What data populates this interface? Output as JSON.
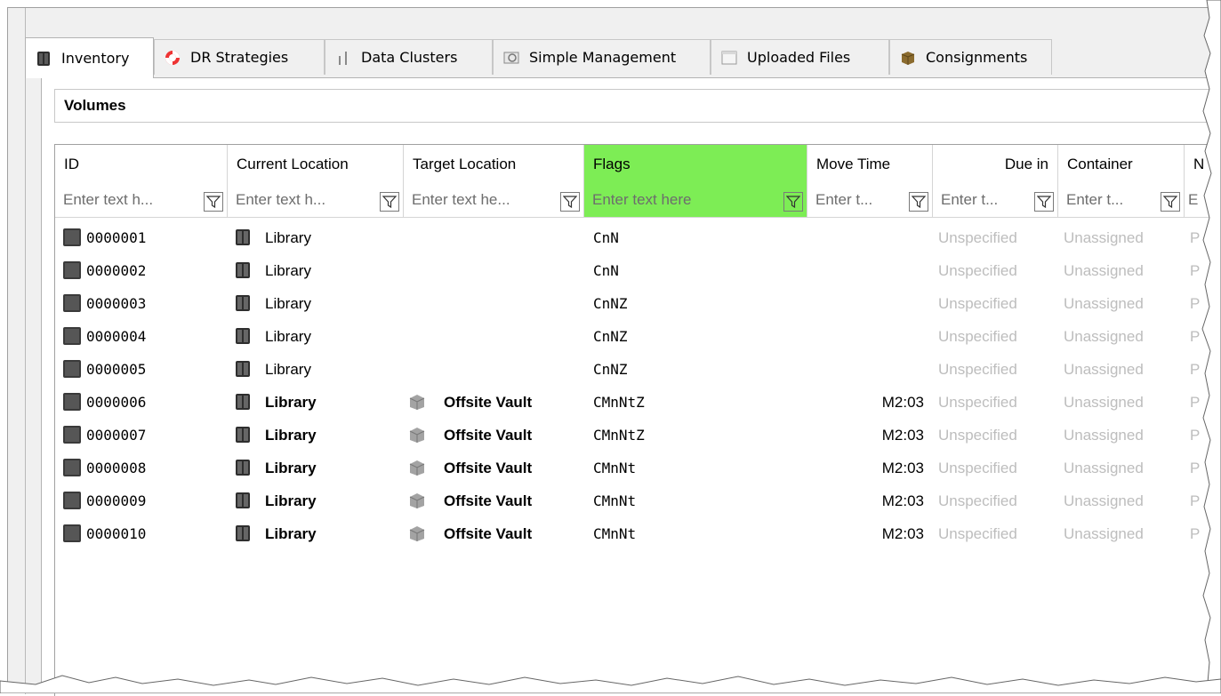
{
  "tabs": [
    {
      "label": "Inventory",
      "icon": "inventory-icon",
      "active": true
    },
    {
      "label": "DR Strategies",
      "icon": "lifebuoy-icon",
      "active": false
    },
    {
      "label": "Data Clusters",
      "icon": "data-clusters-icon",
      "active": false
    },
    {
      "label": "Simple Management",
      "icon": "simple-management-icon",
      "active": false
    },
    {
      "label": "Uploaded Files",
      "icon": "uploaded-files-icon",
      "active": false
    },
    {
      "label": "Consignments",
      "icon": "consignments-icon",
      "active": false
    }
  ],
  "section": {
    "title": "Volumes"
  },
  "grid": {
    "columns": [
      {
        "title": "ID",
        "filter_placeholder": "Enter text h..."
      },
      {
        "title": "Current Location",
        "filter_placeholder": "Enter text h..."
      },
      {
        "title": "Target Location",
        "filter_placeholder": "Enter text he..."
      },
      {
        "title": "Flags",
        "filter_placeholder": "Enter text here",
        "selected": true
      },
      {
        "title": "Move Time",
        "filter_placeholder": "Enter t..."
      },
      {
        "title": "Due in",
        "filter_placeholder": "Enter t..."
      },
      {
        "title": "Container",
        "filter_placeholder": "Enter t..."
      },
      {
        "title": "N",
        "filter_placeholder": "E"
      }
    ],
    "rows": [
      {
        "id": "0000001",
        "current": "Library",
        "target": "",
        "flags": "CnN",
        "move_time": "",
        "due_in": "Unspecified",
        "container": "Unassigned",
        "next": "P",
        "bold": false
      },
      {
        "id": "0000002",
        "current": "Library",
        "target": "",
        "flags": "CnN",
        "move_time": "",
        "due_in": "Unspecified",
        "container": "Unassigned",
        "next": "P",
        "bold": false
      },
      {
        "id": "0000003",
        "current": "Library",
        "target": "",
        "flags": "CnNZ",
        "move_time": "",
        "due_in": "Unspecified",
        "container": "Unassigned",
        "next": "P",
        "bold": false
      },
      {
        "id": "0000004",
        "current": "Library",
        "target": "",
        "flags": "CnNZ",
        "move_time": "",
        "due_in": "Unspecified",
        "container": "Unassigned",
        "next": "P",
        "bold": false
      },
      {
        "id": "0000005",
        "current": "Library",
        "target": "",
        "flags": "CnNZ",
        "move_time": "",
        "due_in": "Unspecified",
        "container": "Unassigned",
        "next": "P",
        "bold": false
      },
      {
        "id": "0000006",
        "current": "Library",
        "target": "Offsite Vault",
        "flags": "CMnNtZ",
        "move_time": "M2:03",
        "due_in": "Unspecified",
        "container": "Unassigned",
        "next": "P",
        "bold": true
      },
      {
        "id": "0000007",
        "current": "Library",
        "target": "Offsite Vault",
        "flags": "CMnNtZ",
        "move_time": "M2:03",
        "due_in": "Unspecified",
        "container": "Unassigned",
        "next": "P",
        "bold": true
      },
      {
        "id": "0000008",
        "current": "Library",
        "target": "Offsite Vault",
        "flags": "CMnNt",
        "move_time": "M2:03",
        "due_in": "Unspecified",
        "container": "Unassigned",
        "next": "P",
        "bold": true
      },
      {
        "id": "0000009",
        "current": "Library",
        "target": "Offsite Vault",
        "flags": "CMnNt",
        "move_time": "M2:03",
        "due_in": "Unspecified",
        "container": "Unassigned",
        "next": "P",
        "bold": true
      },
      {
        "id": "0000010",
        "current": "Library",
        "target": "Offsite Vault",
        "flags": "CMnNt",
        "move_time": "M2:03",
        "due_in": "Unspecified",
        "container": "Unassigned",
        "next": "P",
        "bold": true
      }
    ]
  },
  "colors": {
    "selected_column": "#7ded55",
    "disabled_text": "#bdbdbd"
  }
}
